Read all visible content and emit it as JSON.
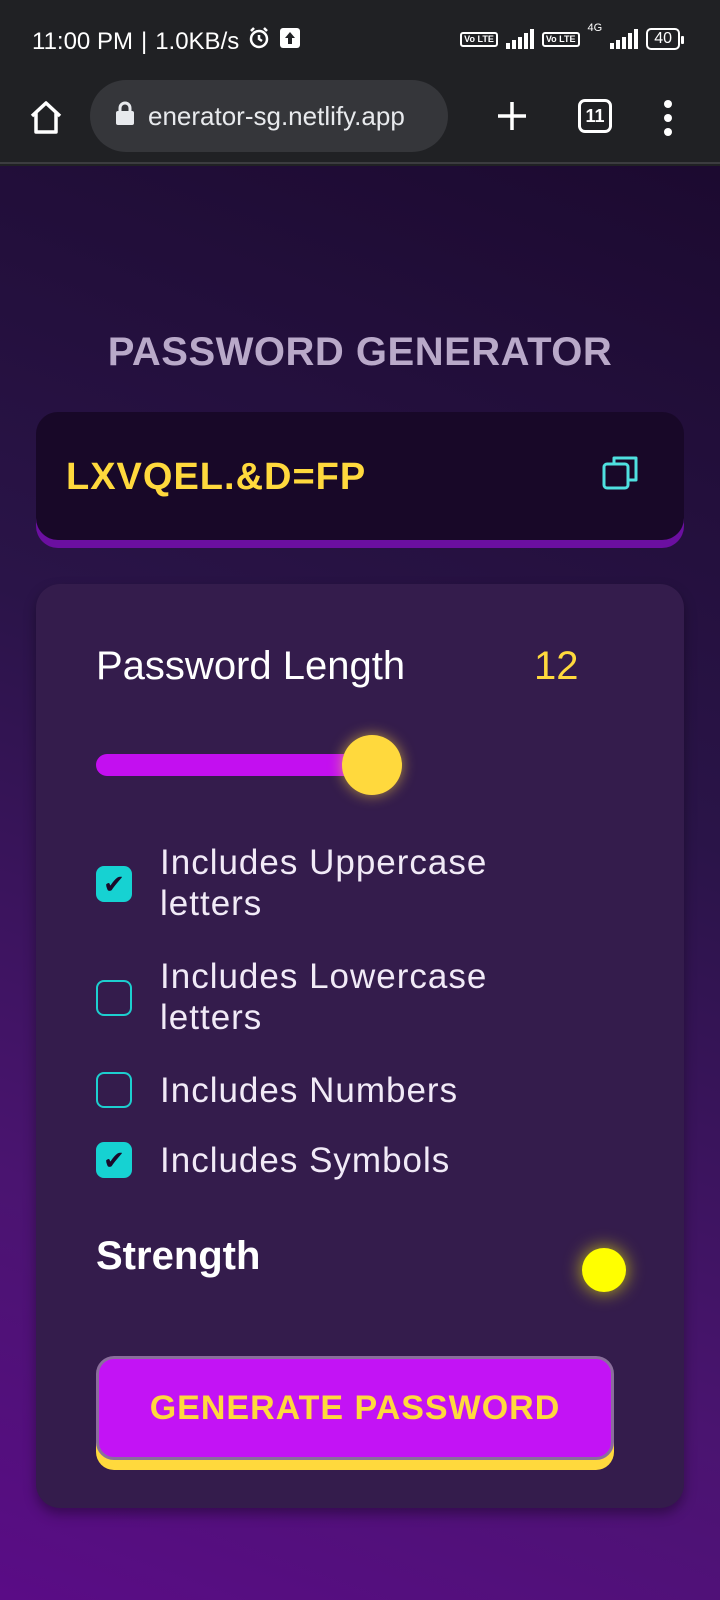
{
  "status_bar": {
    "time": "11:00 PM",
    "separator": "|",
    "net_speed": "1.0KB/s",
    "volte_label": "Vo LTE",
    "network_type": "4G",
    "battery": "40",
    "icons": [
      "alarm-icon",
      "upload-icon",
      "signal-icon",
      "battery-icon"
    ]
  },
  "browser": {
    "url": "enerator-sg.netlify.app",
    "tab_count": "11",
    "icons": [
      "home-icon",
      "lock-icon",
      "plus-icon",
      "tabs-icon",
      "more-vert-icon"
    ]
  },
  "app": {
    "title": "PASSWORD GENERATOR",
    "password": "LXVQEL.&D=FP",
    "copy_icon": "copy-icon",
    "length_label": "Password Length",
    "length_value": "12",
    "slider_fraction": 0.92,
    "options": [
      {
        "label": "Includes Uppercase letters",
        "checked": true
      },
      {
        "label": "Includes Lowercase letters",
        "checked": false
      },
      {
        "label": "Includes Numbers",
        "checked": false
      },
      {
        "label": "Includes Symbols",
        "checked": true
      }
    ],
    "strength_label": "Strength",
    "strength_color": "#ffff00",
    "generate_label": "GENERATE PASSWORD"
  },
  "colors": {
    "accent_yellow": "#ffd93d",
    "accent_purple": "#c313f5",
    "checkbox_cyan": "#16d2d2"
  }
}
